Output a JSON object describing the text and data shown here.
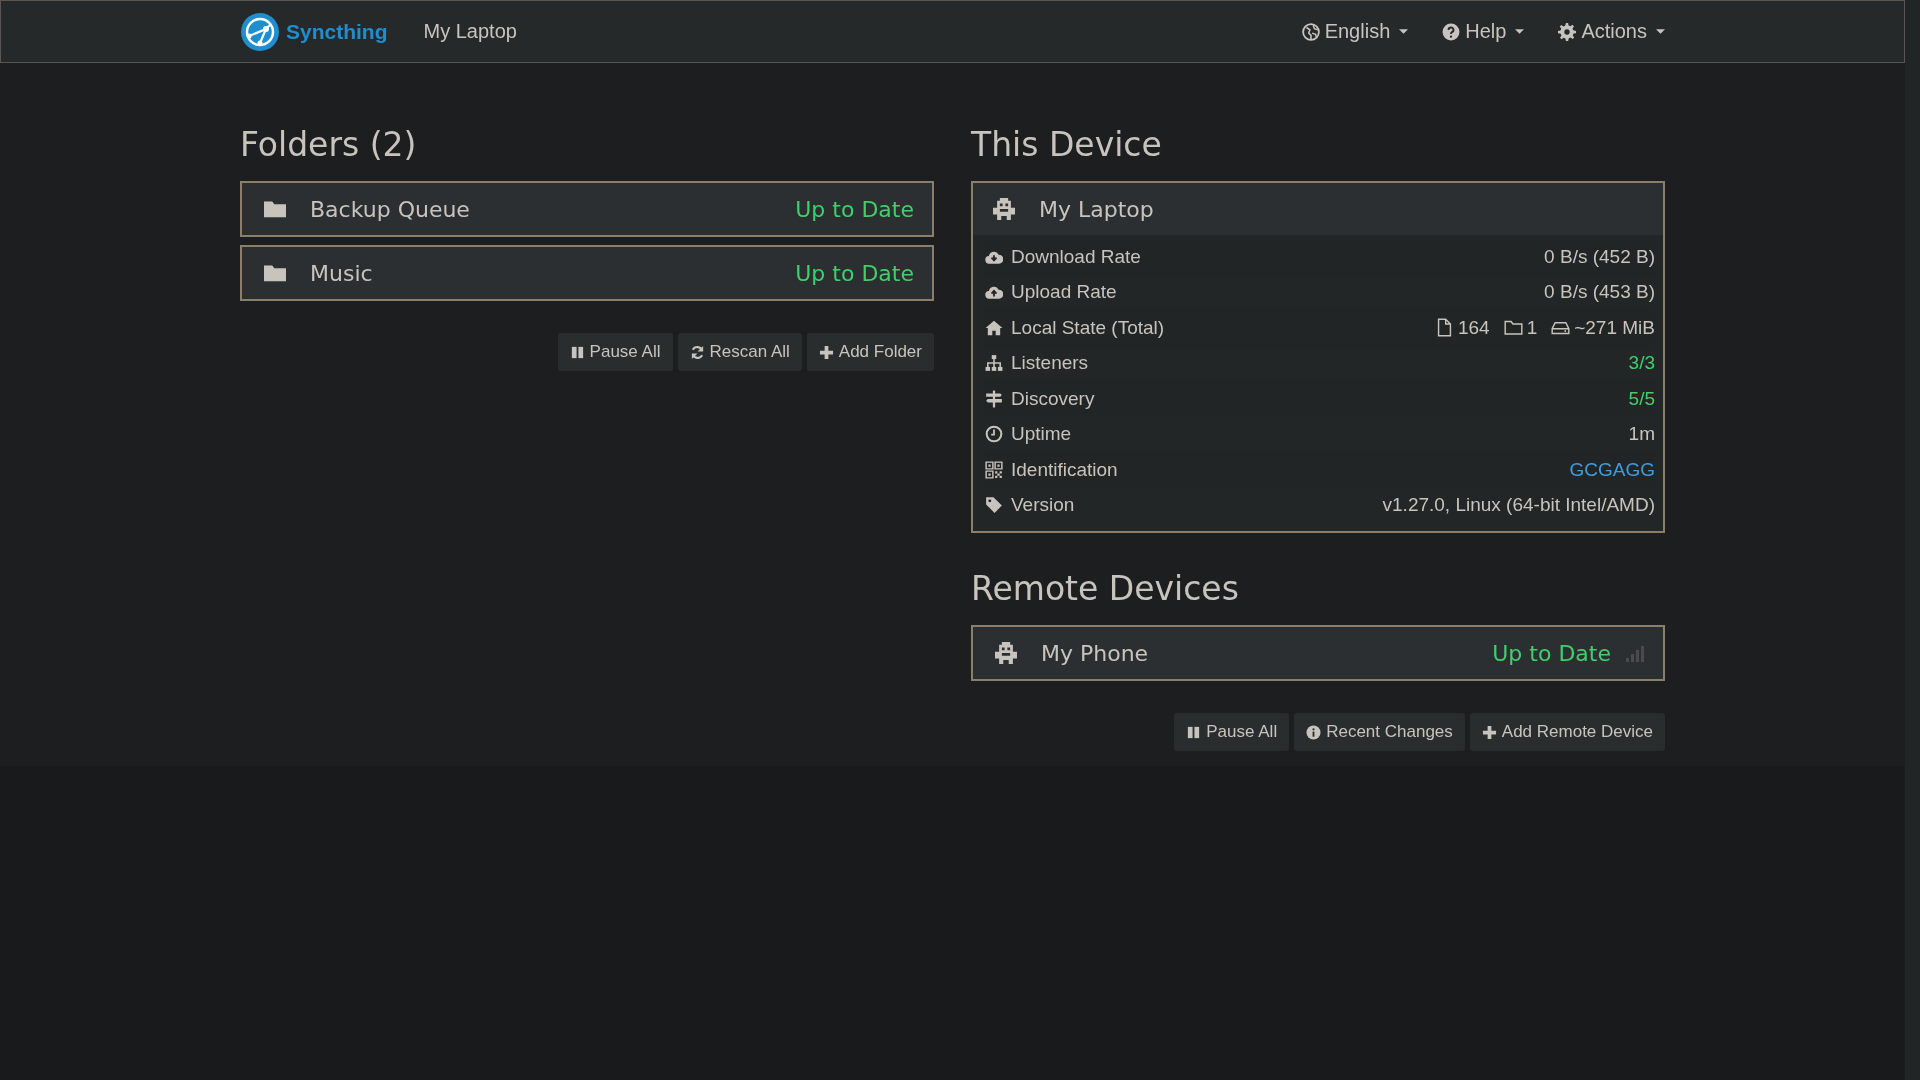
{
  "navbar": {
    "brand": "Syncthing",
    "device_name": "My Laptop",
    "menus": [
      {
        "label": "English",
        "kind": "globe"
      },
      {
        "label": "Help",
        "kind": "question"
      },
      {
        "label": "Actions",
        "kind": "gear"
      }
    ]
  },
  "folders": {
    "title": "Folders (2)",
    "items": [
      {
        "name": "Backup Queue",
        "status": "Up to Date"
      },
      {
        "name": "Music",
        "status": "Up to Date"
      }
    ],
    "buttons": [
      {
        "label": "Pause All",
        "kind": "pause"
      },
      {
        "label": "Rescan All",
        "kind": "refresh"
      },
      {
        "label": "Add Folder",
        "kind": "plus"
      }
    ]
  },
  "this_device": {
    "title": "This Device",
    "name": "My Laptop",
    "rows": [
      {
        "label": "Download Rate",
        "kind": "cloud-down",
        "value": "0 B/s (452 B)",
        "color": "#c8c3bc"
      },
      {
        "label": "Upload Rate",
        "kind": "cloud-up",
        "value": "0 B/s (453 B)",
        "color": "#c8c3bc"
      },
      {
        "label": "Local State (Total)",
        "kind": "home",
        "parts": [
          {
            "kind": "file",
            "text": "164"
          },
          {
            "kind": "folder",
            "text": "1"
          },
          {
            "kind": "drive",
            "text": "~271 MiB"
          }
        ]
      },
      {
        "label": "Listeners",
        "kind": "sitemap",
        "value": "3/3",
        "color": "#3fcf6b"
      },
      {
        "label": "Discovery",
        "kind": "signpost",
        "value": "5/5",
        "color": "#3fcf6b"
      },
      {
        "label": "Uptime",
        "kind": "clock",
        "value": "1m",
        "color": "#c8c3bc"
      },
      {
        "label": "Identification",
        "kind": "qrcode",
        "value": "GCGAGG",
        "color": "#3d9de0"
      },
      {
        "label": "Version",
        "kind": "tag",
        "value": "v1.27.0, Linux (64-bit Intel/AMD)",
        "color": "#c8c3bc"
      }
    ]
  },
  "remote_devices": {
    "title": "Remote Devices",
    "items": [
      {
        "name": "My Phone",
        "status": "Up to Date"
      }
    ],
    "buttons": [
      {
        "label": "Pause All",
        "kind": "pause"
      },
      {
        "label": "Recent Changes",
        "kind": "info"
      },
      {
        "label": "Add Remote Device",
        "kind": "plus"
      }
    ]
  }
}
